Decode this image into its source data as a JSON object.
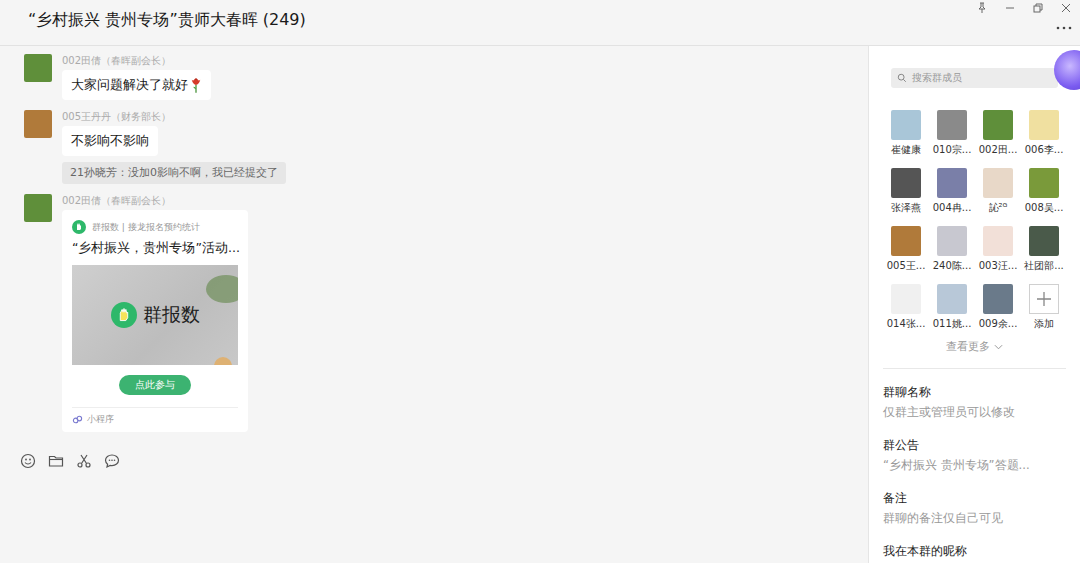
{
  "window": {
    "title": "“乡村振兴 贵州专场”贵师大春晖 (249)"
  },
  "messages": [
    {
      "kind": "text",
      "sender": "002田倩（春晖副会长）",
      "text": "大家问题解决了就好",
      "color": "#5f8f3a"
    },
    {
      "kind": "text",
      "sender": "005王丹丹（财务部长）",
      "text": "不影响不影响",
      "color": "#b07a3a"
    },
    {
      "kind": "quote",
      "text": "21孙晓芳：没加0影响不啊，我已经提交了"
    },
    {
      "kind": "card",
      "sender": "002田倩（春晖副会长）",
      "color": "#5f8f3a",
      "source": "群报数 | 接龙报名预约统计",
      "title": "“乡村振兴，贵州专场”活动...",
      "logo": "群报数",
      "button": "点此参与",
      "footer": "小程序"
    }
  ],
  "search": {
    "placeholder": "搜索群成员"
  },
  "members": [
    {
      "name": "崔健康",
      "color": "#a9c6d8"
    },
    {
      "name": "010宗...",
      "color": "#8a8a8a"
    },
    {
      "name": "002田...",
      "color": "#5f8f3a"
    },
    {
      "name": "006李...",
      "color": "#f0e0a0"
    },
    {
      "name": "张泽燕",
      "color": "#555555"
    },
    {
      "name": "004冉...",
      "color": "#7a7fa8"
    },
    {
      "name": "訫²ᴳ",
      "color": "#e8d8c8"
    },
    {
      "name": "008吴...",
      "color": "#7a9a3a"
    },
    {
      "name": "005王...",
      "color": "#b07a3a"
    },
    {
      "name": "240陈...",
      "color": "#c8c8d0"
    },
    {
      "name": "003汪...",
      "color": "#f2e0d8"
    },
    {
      "name": "社团部...",
      "color": "#4a5a4a"
    },
    {
      "name": "014张...",
      "color": "#f0f0f0"
    },
    {
      "name": "011姚...",
      "color": "#b8c8d8"
    },
    {
      "name": "009余...",
      "color": "#6a7a8a"
    }
  ],
  "add_label": "添加",
  "more_label": "查看更多",
  "settings": [
    {
      "label": "群聊名称",
      "value": "仅群主或管理员可以修改"
    },
    {
      "label": "群公告",
      "value": "“乡村振兴  贵州专场”答题..."
    },
    {
      "label": "备注",
      "value": "群聊的备注仅自己可见"
    },
    {
      "label": "我在本群的昵称",
      "value": ""
    }
  ]
}
